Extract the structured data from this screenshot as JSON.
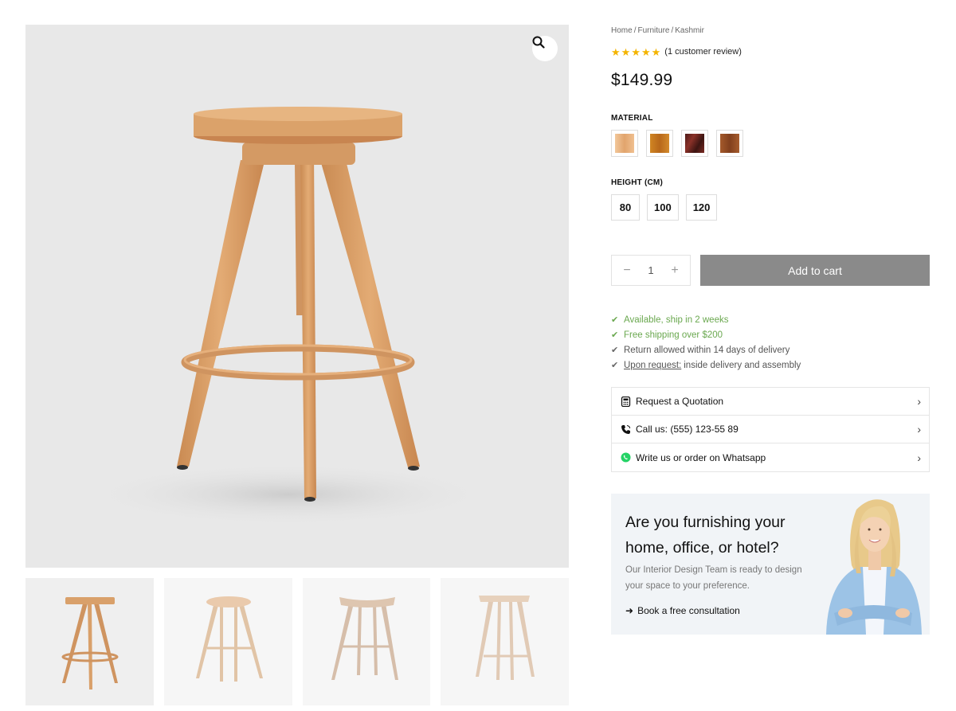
{
  "breadcrumb": {
    "home": "Home",
    "category": "Furniture",
    "current": "Kashmir",
    "separator": "/"
  },
  "rating": {
    "stars": 5,
    "max": 5,
    "review_text": "(1 customer review)",
    "star_color": "#f4b400"
  },
  "price": "$149.99",
  "material": {
    "label": "MATERIAL",
    "swatches": [
      {
        "name": "light-wood",
        "color": "#e7b07c"
      },
      {
        "name": "oak",
        "color": "#c8781e"
      },
      {
        "name": "mahogany",
        "color": "#6b2620"
      },
      {
        "name": "walnut",
        "color": "#9b5428"
      }
    ]
  },
  "height": {
    "label": "HEIGHT (CM)",
    "options": [
      "80",
      "100",
      "120"
    ]
  },
  "cart": {
    "quantity": "1",
    "minus": "−",
    "plus": "+",
    "add_label": "Add to cart",
    "button_color": "#8a8a8a"
  },
  "features": [
    {
      "text": "Available, ship in 2 weeks",
      "style": "green"
    },
    {
      "text": "Free shipping over $200",
      "style": "green"
    },
    {
      "text": "Return allowed within 14 days of delivery",
      "style": "gray"
    },
    {
      "link": "Upon request:",
      "text": "inside delivery and assembly",
      "style": "gray"
    }
  ],
  "actions": [
    {
      "icon": "calculator-icon",
      "label": "Request a Quotation"
    },
    {
      "icon": "phone-icon",
      "label": "Call us: (555) 123-55 89"
    },
    {
      "icon": "whatsapp-icon",
      "label": "Write us or order on Whatsapp"
    }
  ],
  "promo": {
    "heading": "Are you furnishing your home, office, or hotel?",
    "body": "Our Interior Design Team is ready to design your space to your preference.",
    "cta": "Book a free consultation"
  },
  "colors": {
    "accent_green": "#6aa84f",
    "wood": "#d9a06a",
    "bg_image": "#e8e8e8"
  }
}
